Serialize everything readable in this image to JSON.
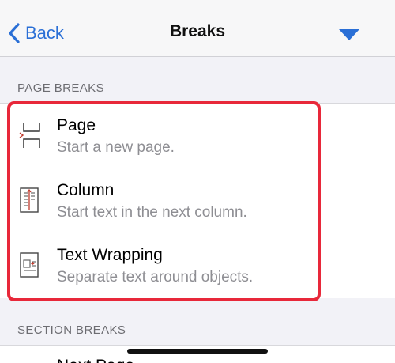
{
  "navbar": {
    "back_label": "Back",
    "title": "Breaks",
    "accent": "#2a6fd6"
  },
  "sections": {
    "page_breaks": {
      "header": "PAGE BREAKS",
      "items": [
        {
          "title": "Page",
          "subtitle": "Start a new page.",
          "icon": "page-break-icon"
        },
        {
          "title": "Column",
          "subtitle": "Start text in the next column.",
          "icon": "column-break-icon"
        },
        {
          "title": "Text Wrapping",
          "subtitle": "Separate text around objects.",
          "icon": "text-wrapping-icon"
        }
      ]
    },
    "section_breaks": {
      "header": "SECTION BREAKS",
      "partial_item_title": "Next Page"
    }
  },
  "highlight_color": "#e8283a"
}
